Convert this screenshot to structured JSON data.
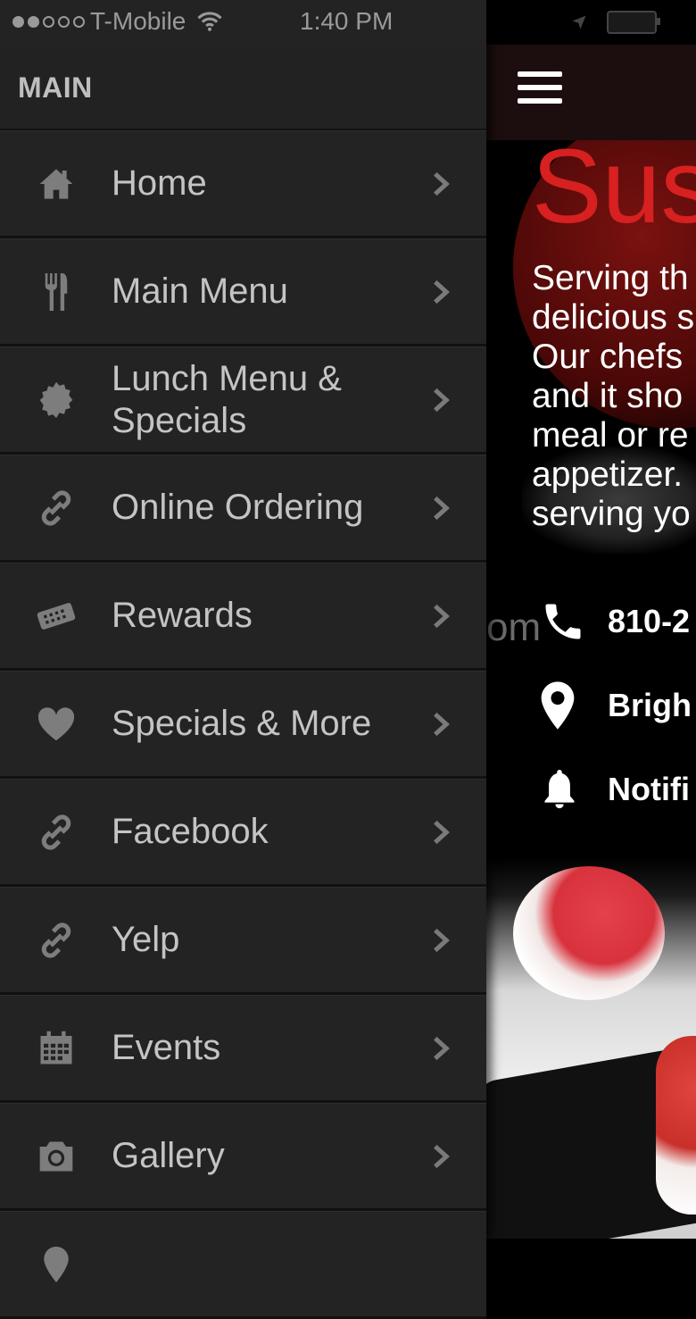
{
  "status_bar": {
    "carrier": "T-Mobile",
    "time": "1:40 PM",
    "signal_dots_filled": 2,
    "signal_dots_total": 5
  },
  "drawer": {
    "section_title": "MAIN",
    "items": [
      {
        "label": "Home",
        "icon": "home-icon"
      },
      {
        "label": "Main Menu",
        "icon": "fork-knife-icon"
      },
      {
        "label": "Lunch Menu & Specials",
        "icon": "badge-icon"
      },
      {
        "label": "Online Ordering",
        "icon": "link-icon"
      },
      {
        "label": "Rewards",
        "icon": "ticket-icon"
      },
      {
        "label": "Specials & More",
        "icon": "heart-icon"
      },
      {
        "label": "Facebook",
        "icon": "link-icon"
      },
      {
        "label": "Yelp",
        "icon": "link-icon"
      },
      {
        "label": "Events",
        "icon": "calendar-icon"
      },
      {
        "label": "Gallery",
        "icon": "camera-icon"
      }
    ]
  },
  "content": {
    "hero_title": "Sus",
    "hero_text": "Serving th\ndelicious s\nOur chefs\nand it sho\nmeal or re\nappetizer.\nserving yo",
    "ghost_text": "om",
    "phone": "810-2",
    "location": "Brigh",
    "notifications": "Notifi"
  },
  "colors": {
    "drawer_bg": "#232323",
    "brand_red": "#d72020",
    "text_gray": "#c4c4c4"
  }
}
